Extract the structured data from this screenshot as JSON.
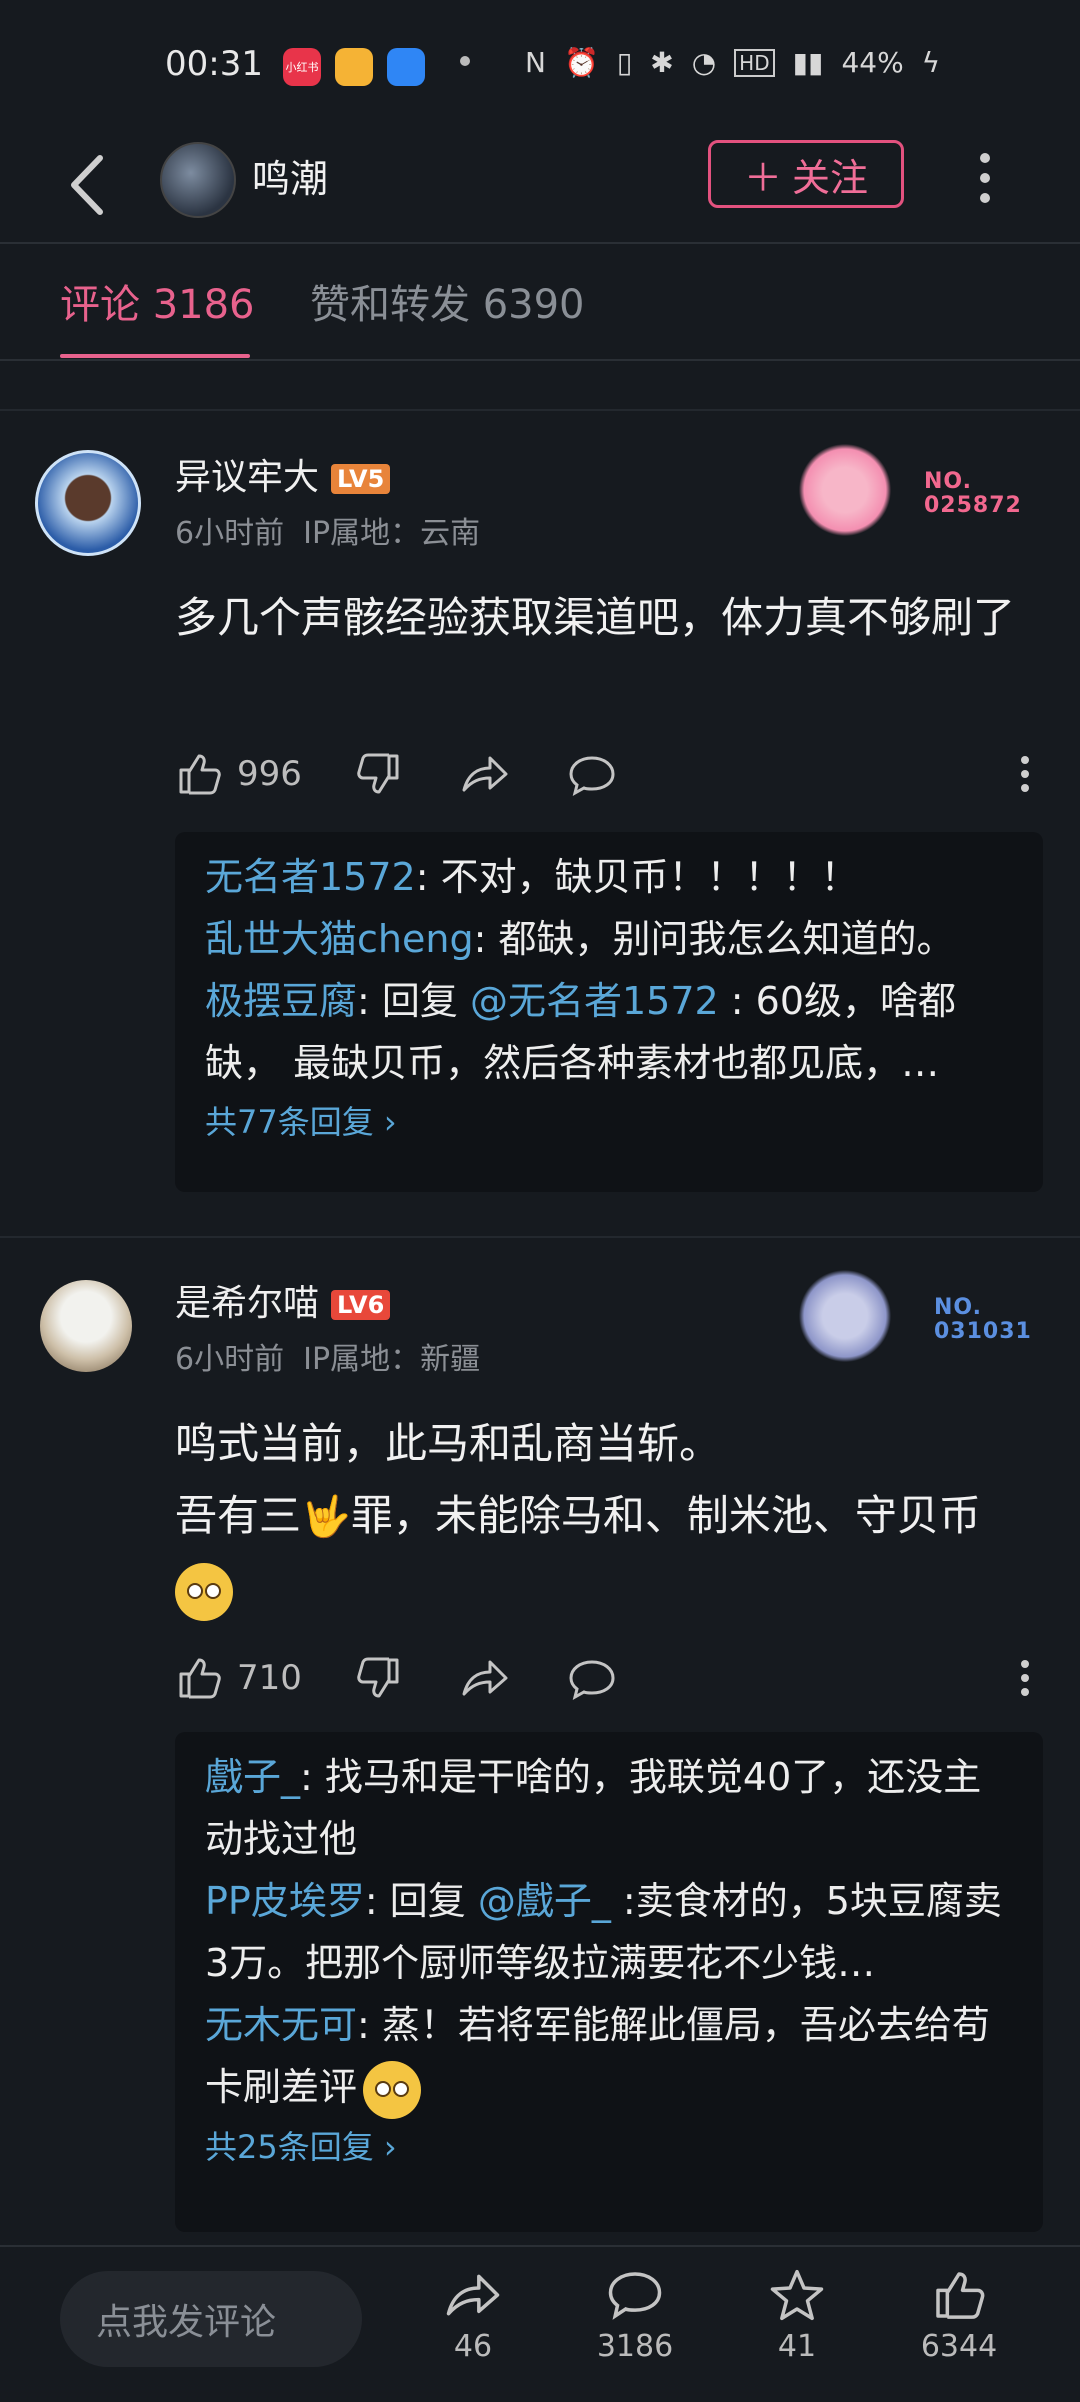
{
  "status_bar": {
    "time": "00:31",
    "apps": [
      {
        "name": "小红书",
        "color": "#e8344a"
      },
      {
        "name": "微博",
        "color": "#f5b335"
      },
      {
        "name": "app",
        "color": "#2f86f5"
      }
    ],
    "battery": "44%"
  },
  "header": {
    "title": "鸣潮",
    "follow_label": "关注"
  },
  "tabs": [
    {
      "label": "评论 3186"
    },
    {
      "label": "赞和转发 6390"
    }
  ],
  "comments": [
    {
      "user": "异议牢大",
      "level": "LV5",
      "level_color": "#e8843a",
      "time": "6小时前",
      "ip": "IP属地：云南",
      "deco_no": "NO.\n025872",
      "deco_color": "#f2688f",
      "text": "多几个声骸经验获取渠道吧，体力真不够刷了",
      "likes": "996",
      "replies": [
        {
          "user": "无名者1572",
          "text": ": 不对，缺贝币！！！！！"
        },
        {
          "user": "乱世大猫cheng",
          "text": ": 都缺，别问我怎么知道的。"
        },
        {
          "user": "极摆豆腐",
          "prefix": ": 回复 ",
          "at": "@无名者1572",
          "text": " : 60级，啥都缺， 最缺贝币，然后各种素材也都见底，…"
        }
      ],
      "more_replies": "共77条回复 ›"
    },
    {
      "user": "是希尔喵",
      "level": "LV6",
      "level_color": "#e8483a",
      "time": "6小时前",
      "ip": "IP属地：新疆",
      "deco_no": "NO.\n031031",
      "deco_color": "#5b8fe0",
      "text_line1": "鸣式当前，此马和乱商当斩。",
      "text_line2a": "吾有三",
      "text_line2b": "罪，未能除马和、制米池、守贝币",
      "likes": "710",
      "replies": [
        {
          "user": "戲子_",
          "text": ": 找马和是干啥的，我联觉40了，还没主动找过他"
        },
        {
          "user": "PP皮埃罗",
          "prefix": ": 回复 ",
          "at": "@戲子_",
          "text": " :卖食材的，5块豆腐卖3万。把那个厨师等级拉满要花不少钱…"
        },
        {
          "user": "无木无可",
          "text": ": 蒸！若将军能解此僵局，吾必去给苟卡刷差评"
        }
      ],
      "more_replies": "共25条回复 ›"
    }
  ],
  "bottom_bar": {
    "input_placeholder": "点我发评论",
    "share_count": "46",
    "comment_count": "3186",
    "star_count": "41",
    "like_count": "6344"
  }
}
